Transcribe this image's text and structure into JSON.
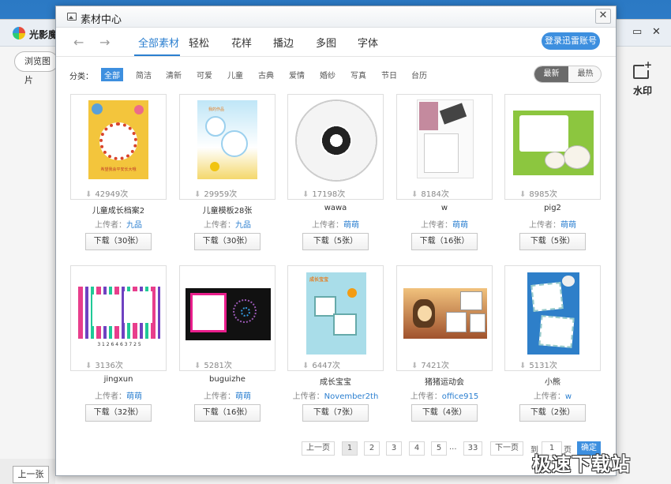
{
  "background_app": {
    "name": "光影魔",
    "browse_label": "浏览图片",
    "watermark_label": "水印",
    "prev_label": "上一张",
    "min_glyph": "▭",
    "close_glyph": "✕"
  },
  "dialog": {
    "title": "素材中心",
    "close_glyph": "✕",
    "nav": {
      "back_glyph": "←",
      "forward_glyph": "→"
    },
    "tabs": [
      {
        "label": "全部素材",
        "active": true
      },
      {
        "label": "轻松"
      },
      {
        "label": "花样"
      },
      {
        "label": "播边"
      },
      {
        "label": "多图"
      },
      {
        "label": "字体"
      }
    ],
    "login_label": "登录迅雷账号",
    "filter_label": "分类：",
    "categories": [
      "全部",
      "简洁",
      "清新",
      "可爱",
      "儿童",
      "古典",
      "爱情",
      "婚纱",
      "写真",
      "节日",
      "台历"
    ],
    "active_category": "全部",
    "sort": {
      "newest": "最新",
      "hottest": "最热",
      "active": "最新"
    },
    "uploader_prefix": "上传者：",
    "items": [
      {
        "downloads": "42949次",
        "name": "儿童成长档案2",
        "uploader": "九品",
        "button": "下载（30张）"
      },
      {
        "downloads": "29959次",
        "name": "儿童模板28张",
        "uploader": "九品",
        "button": "下载（30张）"
      },
      {
        "downloads": "17198次",
        "name": "wawa",
        "uploader": "萌萌",
        "button": "下载（5张）"
      },
      {
        "downloads": "8184次",
        "name": "w",
        "uploader": "萌萌",
        "button": "下载（16张）"
      },
      {
        "downloads": "8985次",
        "name": "pig2",
        "uploader": "萌萌",
        "button": "下载（5张）"
      },
      {
        "downloads": "3136次",
        "name": "jingxun",
        "uploader": "萌萌",
        "button": "下载（32张）"
      },
      {
        "downloads": "5281次",
        "name": "buguizhe",
        "uploader": "萌萌",
        "button": "下载（16张）"
      },
      {
        "downloads": "6447次",
        "name": "成长宝宝",
        "uploader": "November2th",
        "button": "下载（7张）"
      },
      {
        "downloads": "7421次",
        "name": "猪猪运动会",
        "uploader": "office915",
        "button": "下载（4张）"
      },
      {
        "downloads": "5131次",
        "name": "小熊",
        "uploader": "w",
        "button": "下载（2张）"
      }
    ],
    "thumb_text": {
      "kids_poster": "希望我会平安长大哦",
      "kids_template": "我的作品",
      "stripe_digits": "3 1 2 6 4 6 3 7 2 5",
      "growth_baby": "成长宝宝"
    },
    "pagination": {
      "prev": "上一页",
      "pages": [
        "1",
        "2",
        "3",
        "4",
        "5"
      ],
      "ellipsis": "...",
      "last": "33",
      "next": "下一页",
      "goto_prefix": "到",
      "goto_value": "1",
      "goto_suffix": "页",
      "confirm": "确定",
      "current": "1"
    }
  },
  "site_watermark": "极速下载站"
}
